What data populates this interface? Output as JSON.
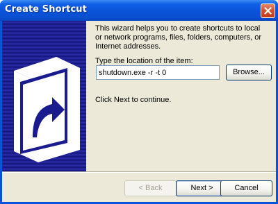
{
  "window": {
    "title": "Create Shortcut",
    "close_icon": "close-icon",
    "accent_color": "#0a53d8"
  },
  "intro_text": "This wizard helps you to create shortcuts to local or network programs, files, folders, computers, or Internet addresses.",
  "location": {
    "label": "Type the location of the item:",
    "value": "shutdown.exe -r -t 0",
    "browse_label": "Browse..."
  },
  "hint": "Click Next to continue.",
  "buttons": {
    "back_label": "< Back",
    "next_label": "Next >",
    "cancel_label": "Cancel"
  },
  "side_panel": {
    "icon": "shortcut-arrow-icon"
  }
}
